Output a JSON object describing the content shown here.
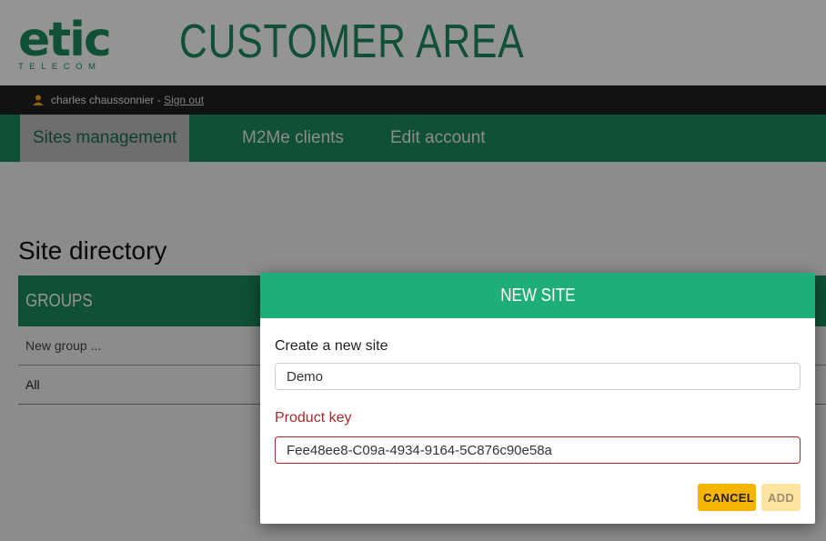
{
  "brand": {
    "logo_word": "etic",
    "logo_sub": "TELECOM",
    "area_title": "CUSTOMER AREA",
    "color": "#1a8a5e"
  },
  "userbar": {
    "user_name": "charles chaussonnier",
    "separator": " - ",
    "sign_out": "Sign out",
    "user_icon": "user-icon"
  },
  "nav": {
    "tabs": [
      {
        "label": "Sites management",
        "active": true
      },
      {
        "label": "M2Me clients",
        "active": false
      },
      {
        "label": "Edit account",
        "active": false
      }
    ]
  },
  "page": {
    "title": "Site directory"
  },
  "groups": {
    "header": "GROUPS",
    "rows": [
      "New group ...",
      "All"
    ]
  },
  "modal": {
    "title": "NEW SITE",
    "site_label": "Create a new site",
    "site_value": "Demo",
    "key_label": "Product key",
    "key_value": "Fee48ee8-C09a-4934-9164-5C876c90e58a",
    "cancel": "CANCEL",
    "add": "ADD"
  }
}
